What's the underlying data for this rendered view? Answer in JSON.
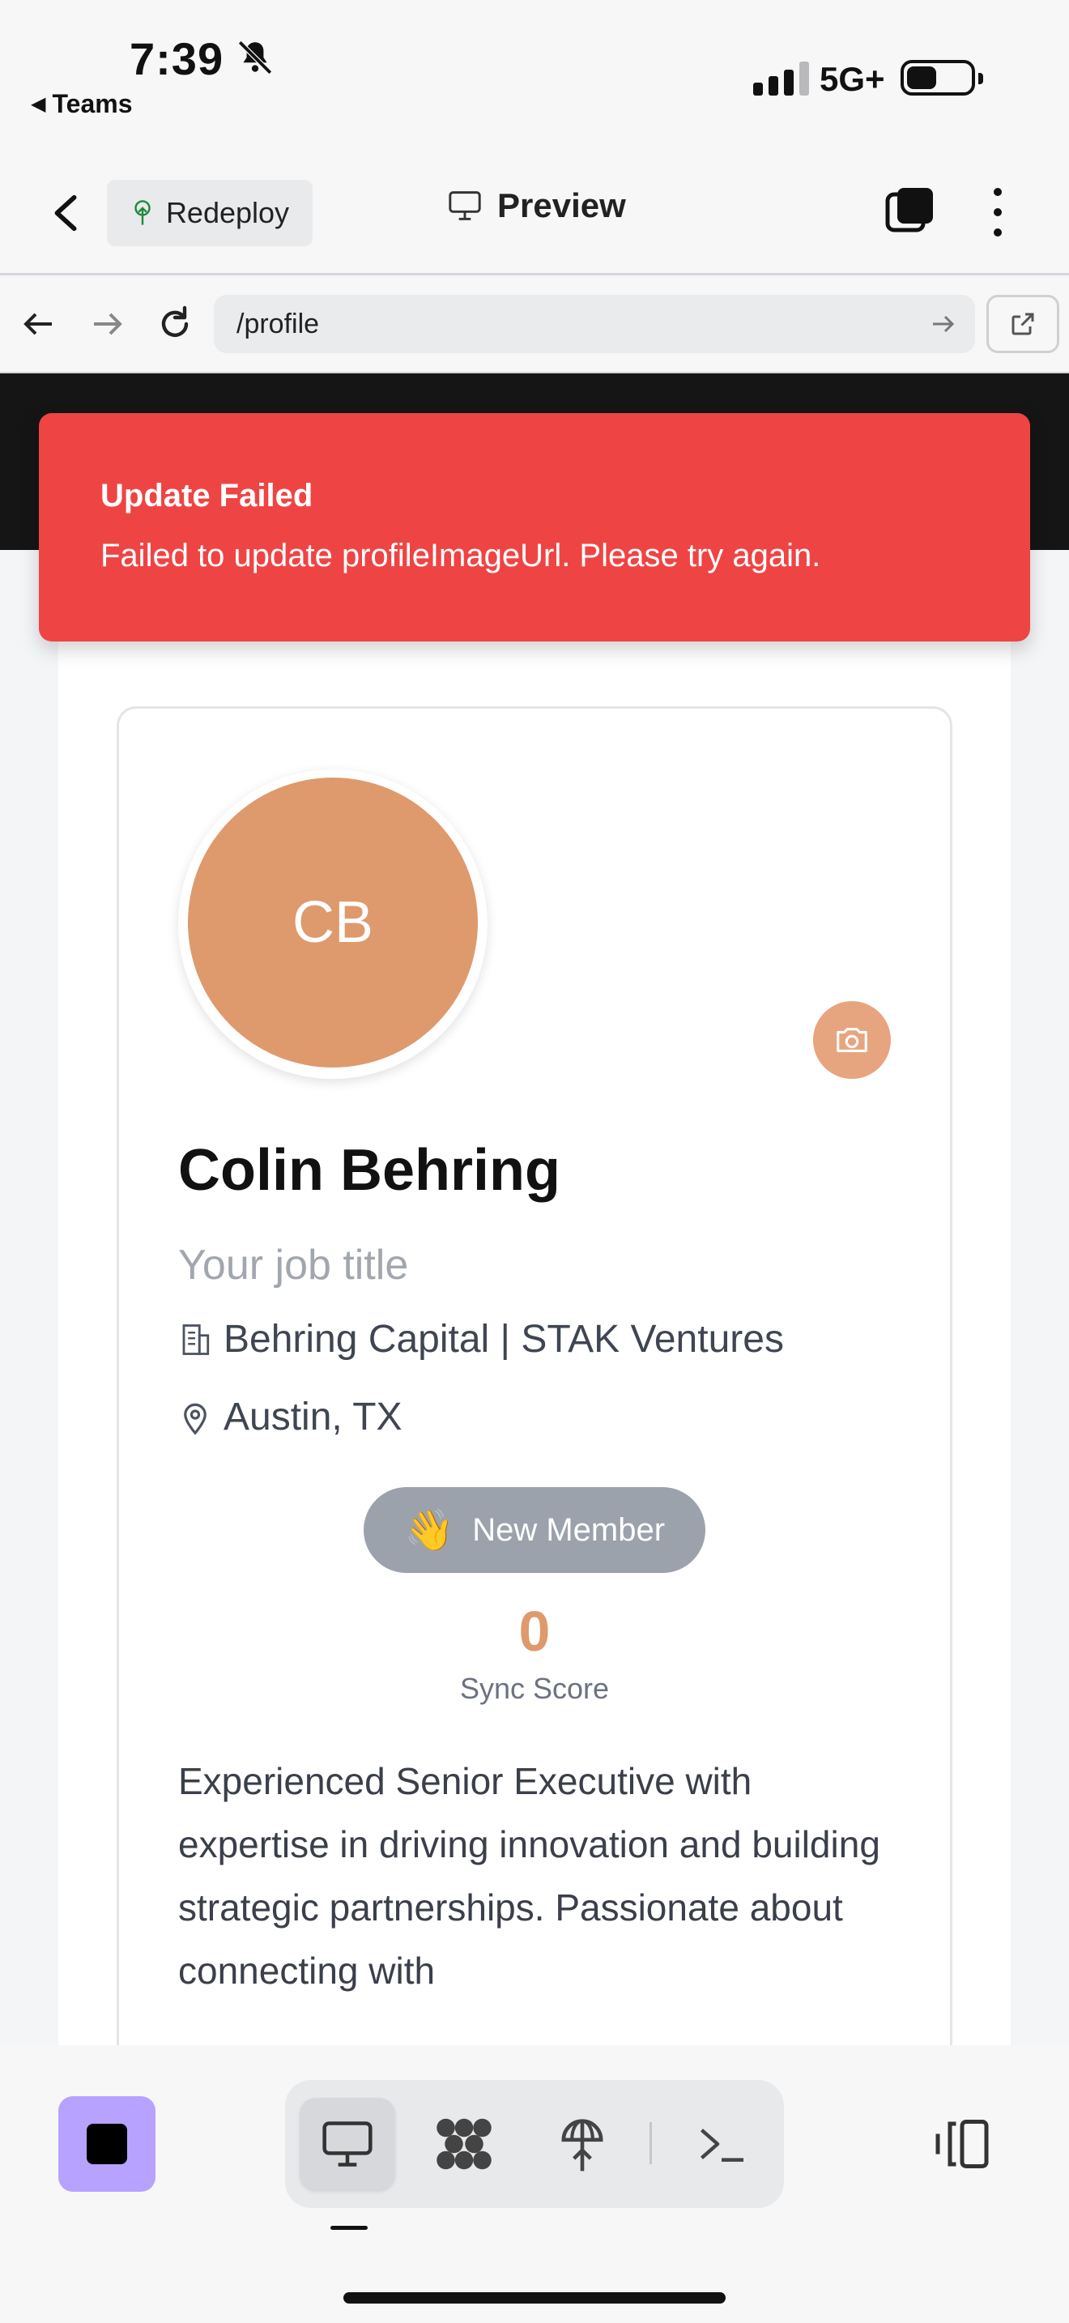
{
  "status_bar": {
    "time": "7:39",
    "back_app": "Teams",
    "network": "5G+"
  },
  "header": {
    "redeploy_label": "Redeploy",
    "preview_label": "Preview"
  },
  "browser": {
    "url": "/profile"
  },
  "toast": {
    "title": "Update Failed",
    "message": "Failed to update profileImageUrl. Please try again.",
    "color": "#ef4444"
  },
  "profile": {
    "initials": "CB",
    "name": "Colin Behring",
    "job_title_placeholder": "Your job title",
    "company": "Behring Capital | STAK Ventures",
    "location": "Austin, TX",
    "badge_emoji": "👋",
    "badge_label": "New Member",
    "sync_score": "0",
    "sync_score_label": "Sync Score",
    "bio": "Experienced Senior Executive with expertise in driving innovation and building strategic partnerships. Passionate about connecting with",
    "avatar_color": "#de9a6c",
    "accent_color": "#de9a6c"
  },
  "dock": {
    "items": [
      {
        "icon": "monitor-icon",
        "active": true
      },
      {
        "icon": "cluster-icon",
        "active": false
      },
      {
        "icon": "deploy-icon",
        "active": false
      },
      {
        "icon": "terminal-icon",
        "active": false
      }
    ],
    "stop_color": "#b7a2ff"
  }
}
